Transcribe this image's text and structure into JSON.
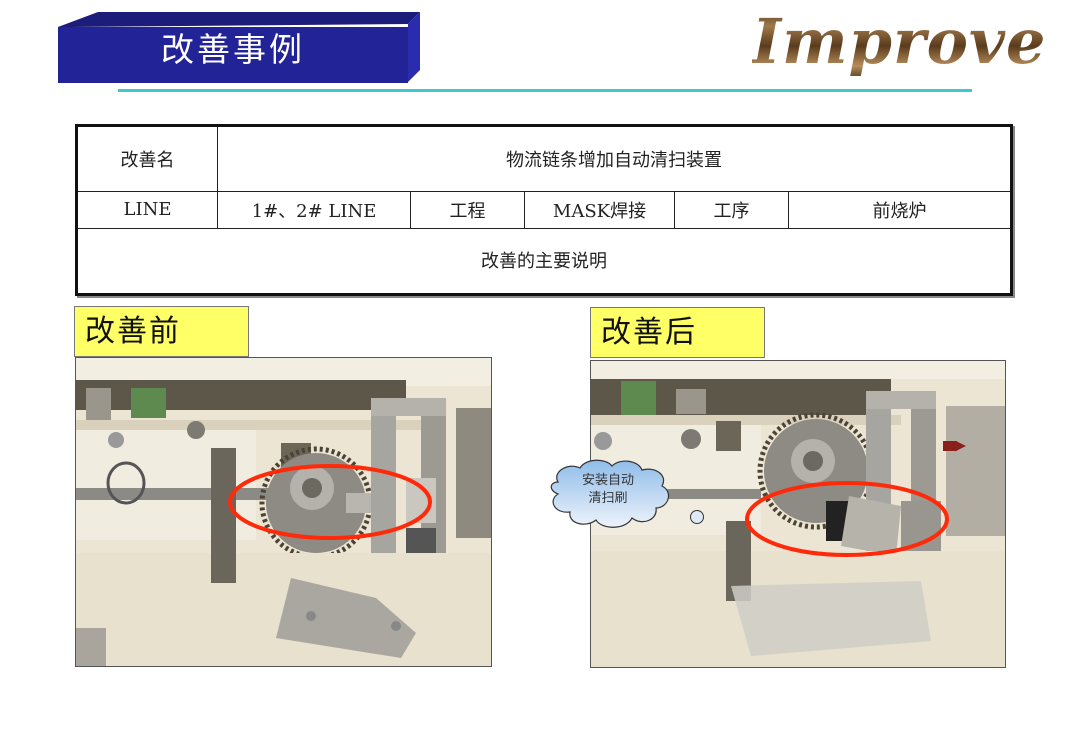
{
  "header": {
    "title": "改善事例",
    "logo_text": "Improve",
    "colors": {
      "banner": "#232398",
      "rule": "#3ec9cf",
      "tag_bg": "#ffff66",
      "highlight": "#ff2a0a"
    }
  },
  "table": {
    "row1": {
      "label": "改善名",
      "value": "物流链条增加自动清扫装置"
    },
    "row2": {
      "line_label": "LINE",
      "line_value": "1#、2# LINE",
      "process_label": "工程",
      "process_value": "MASK焊接",
      "step_label": "工序",
      "step_value": "前烧炉"
    },
    "row3": {
      "description": "改善的主要说明"
    }
  },
  "before": {
    "label": "改善前",
    "photo_desc": "chain sprocket without cleaning brush, circled area"
  },
  "after": {
    "label": "改善后",
    "photo_desc": "chain sprocket with automatic cleaning brush installed, circled area",
    "callout": [
      "安装自动",
      "清扫刷"
    ]
  }
}
